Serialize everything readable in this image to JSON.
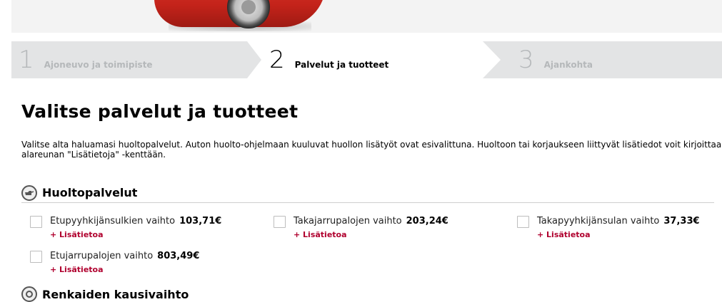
{
  "steps": [
    {
      "num": "1",
      "label": "Ajoneuvo ja toimipiste"
    },
    {
      "num": "2",
      "label": "Palvelut ja tuotteet"
    },
    {
      "num": "3",
      "label": "Ajankohta"
    }
  ],
  "page_title": "Valitse palvelut ja tuotteet",
  "intro_line1": "Valitse alta haluamasi huoltopalvelut. Auton huolto-ohjelmaan kuuluvat huollon lisätyöt ovat esivalittuna. Huoltoon tai korjaukseen liittyvät lisätiedot voit kirjoittaa s",
  "intro_line2": "alareunan \"Lisätietoja\" -kenttään.",
  "section1": {
    "title": "Huoltopalvelut",
    "icon": "oil-can-icon",
    "items": [
      {
        "name": "Etupyyhkijänsulkien vaihto",
        "price": "103,71€",
        "more": "+ Lisätietoa"
      },
      {
        "name": "Takajarrupalojen vaihto",
        "price": "203,24€",
        "more": "+ Lisätietoa"
      },
      {
        "name": "Takapyyhkijänsulan vaihto",
        "price": "37,33€",
        "more": "+ Lisätietoa"
      },
      {
        "name": "Etujarrupalojen vaihto",
        "price": "803,49€",
        "more": "+ Lisätietoa"
      }
    ]
  },
  "section2": {
    "title": "Renkaiden kausivaihto",
    "icon": "tire-icon"
  },
  "colors": {
    "accent": "#b0002e",
    "steps_bg": "#e3e4e5",
    "inactive_step": "#b5b8ba"
  }
}
